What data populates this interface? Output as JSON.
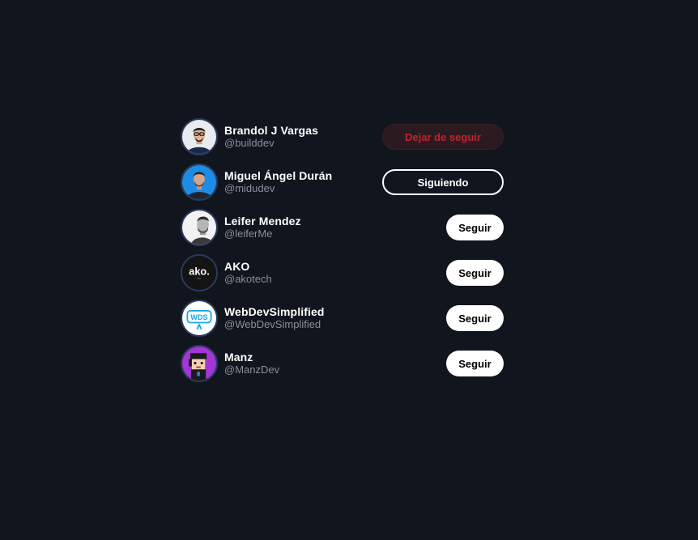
{
  "users": [
    {
      "name": "Brandol J Vargas",
      "handle": "@builddev",
      "button": "Dejar de seguir",
      "state": "unfollow-hover",
      "avatar_icon": "person-glasses-avatar"
    },
    {
      "name": "Miguel Ángel Durán",
      "handle": "@midudev",
      "button": "Siguiendo",
      "state": "following",
      "avatar_icon": "person-blue-background-avatar"
    },
    {
      "name": "Leifer Mendez",
      "handle": "@leiferMe",
      "button": "Seguir",
      "state": "follow",
      "avatar_icon": "person-bw-avatar"
    },
    {
      "name": "AKO",
      "handle": "@akotech",
      "button": "Seguir",
      "state": "follow",
      "avatar_icon": "ako-logo-avatar",
      "avatar_text": "ako."
    },
    {
      "name": "WebDevSimplified",
      "handle": "@WebDevSimplified",
      "button": "Seguir",
      "state": "follow",
      "avatar_icon": "wds-logo-avatar",
      "avatar_text": "WDS"
    },
    {
      "name": "Manz",
      "handle": "@ManzDev",
      "button": "Seguir",
      "state": "follow",
      "avatar_icon": "pixel-art-avatar"
    }
  ],
  "colors": {
    "background": "#11151d",
    "unfollow_text": "#c4222c",
    "unfollow_bg": "#2b1a20",
    "handle_text": "#8a8f98"
  }
}
